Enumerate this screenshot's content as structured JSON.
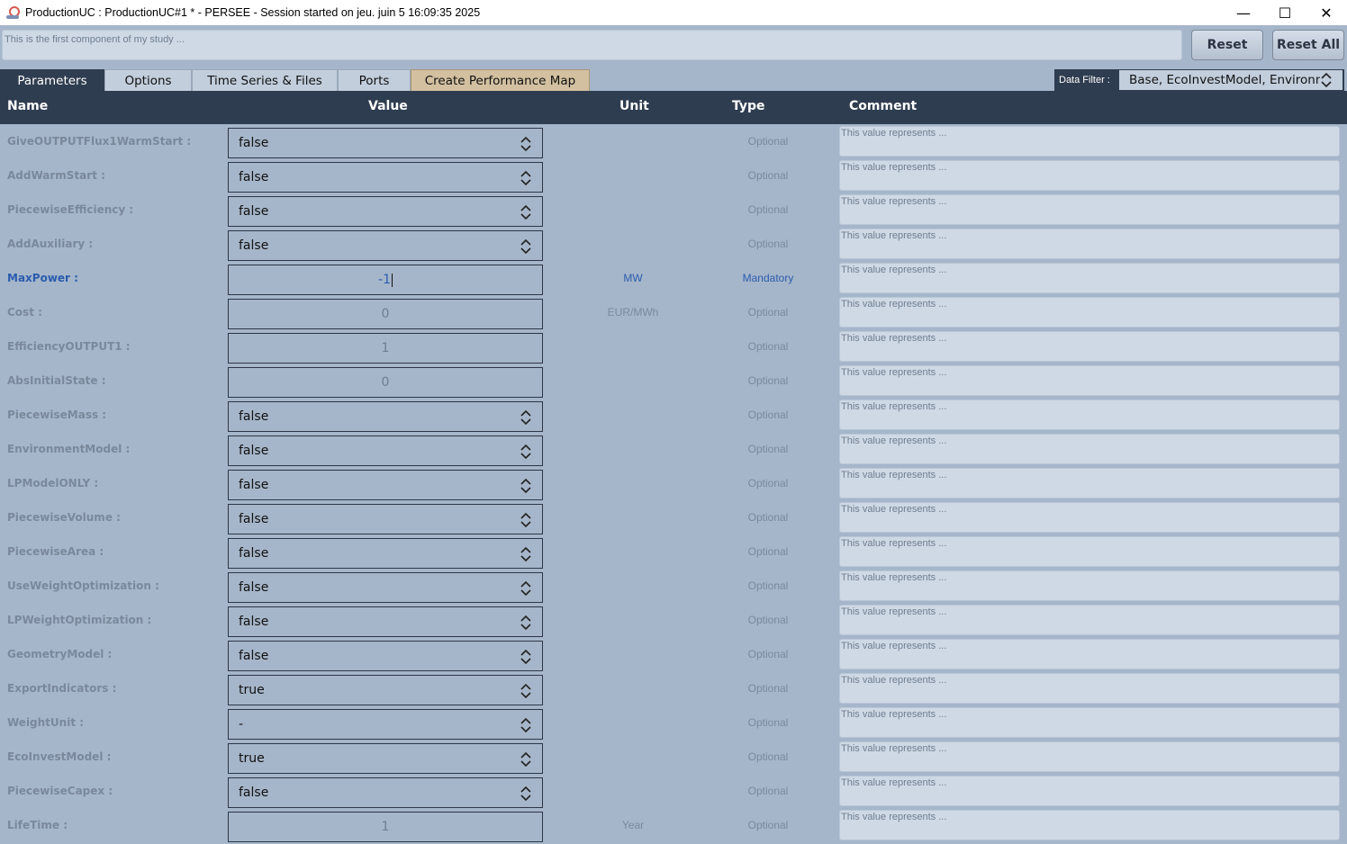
{
  "window": {
    "title": "ProductionUC : ProductionUC#1 * - PERSEE - Session started on jeu. juin 5 16:09:35 2025",
    "minimize": "—",
    "maximize": "☐",
    "close": "✕"
  },
  "description": {
    "placeholder": "This is the first component of my study ..."
  },
  "buttons": {
    "reset": "Reset",
    "reset_all": "Reset All"
  },
  "tabs": [
    {
      "label": "Parameters",
      "active": true
    },
    {
      "label": "Options"
    },
    {
      "label": "Time Series & Files"
    },
    {
      "label": "Ports"
    },
    {
      "label": "Create Performance Map"
    }
  ],
  "filter": {
    "label": "Data Filter :",
    "value": "Base, EcoInvestModel, Environm"
  },
  "columns": {
    "name": "Name",
    "value": "Value",
    "unit": "Unit",
    "type": "Type",
    "comment": "Comment"
  },
  "rows": [
    {
      "name": "GiveOUTPUTFlux1WarmStart :",
      "value": "false",
      "kind": "select",
      "unit": "",
      "type": "Optional",
      "comment": "This value represents ..."
    },
    {
      "name": "AddWarmStart :",
      "value": "false",
      "kind": "select",
      "unit": "",
      "type": "Optional",
      "comment": "This value represents ..."
    },
    {
      "name": "PiecewiseEfficiency :",
      "value": "false",
      "kind": "select",
      "unit": "",
      "type": "Optional",
      "comment": "This value represents ..."
    },
    {
      "name": "AddAuxiliary :",
      "value": "false",
      "kind": "select",
      "unit": "",
      "type": "Optional",
      "comment": "This value represents ..."
    },
    {
      "name": "MaxPower :",
      "value": "-1",
      "kind": "number",
      "editing": true,
      "unit": "MW",
      "type": "Mandatory",
      "comment": "This value represents ..."
    },
    {
      "name": "Cost :",
      "value": "0",
      "kind": "number",
      "unit": "EUR/MWh",
      "type": "Optional",
      "comment": "This value represents ..."
    },
    {
      "name": "EfficiencyOUTPUT1 :",
      "value": "1",
      "kind": "number",
      "unit": "",
      "type": "Optional",
      "comment": "This value represents ..."
    },
    {
      "name": "AbsInitialState :",
      "value": "0",
      "kind": "number",
      "unit": "",
      "type": "Optional",
      "comment": "This value represents ..."
    },
    {
      "name": "PiecewiseMass :",
      "value": "false",
      "kind": "select",
      "unit": "",
      "type": "Optional",
      "comment": "This value represents ..."
    },
    {
      "name": "EnvironmentModel :",
      "value": "false",
      "kind": "select",
      "unit": "",
      "type": "Optional",
      "comment": "This value represents ..."
    },
    {
      "name": "LPModelONLY :",
      "value": "false",
      "kind": "select",
      "unit": "",
      "type": "Optional",
      "comment": "This value represents ..."
    },
    {
      "name": "PiecewiseVolume :",
      "value": "false",
      "kind": "select",
      "unit": "",
      "type": "Optional",
      "comment": "This value represents ..."
    },
    {
      "name": "PiecewiseArea :",
      "value": "false",
      "kind": "select",
      "unit": "",
      "type": "Optional",
      "comment": "This value represents ..."
    },
    {
      "name": "UseWeightOptimization :",
      "value": "false",
      "kind": "select",
      "unit": "",
      "type": "Optional",
      "comment": "This value represents ..."
    },
    {
      "name": "LPWeightOptimization :",
      "value": "false",
      "kind": "select",
      "unit": "",
      "type": "Optional",
      "comment": "This value represents ..."
    },
    {
      "name": "GeometryModel :",
      "value": "false",
      "kind": "select",
      "unit": "",
      "type": "Optional",
      "comment": "This value represents ..."
    },
    {
      "name": "ExportIndicators :",
      "value": "true",
      "kind": "select",
      "unit": "",
      "type": "Optional",
      "comment": "This value represents ..."
    },
    {
      "name": "WeightUnit :",
      "value": "-",
      "kind": "select",
      "unit": "",
      "type": "Optional",
      "comment": "This value represents ..."
    },
    {
      "name": "EcoInvestModel :",
      "value": "true",
      "kind": "select",
      "unit": "",
      "type": "Optional",
      "comment": "This value represents ..."
    },
    {
      "name": "PiecewiseCapex :",
      "value": "false",
      "kind": "select",
      "unit": "",
      "type": "Optional",
      "comment": "This value represents ..."
    },
    {
      "name": "LifeTime :",
      "value": "1",
      "kind": "number",
      "unit": "Year",
      "type": "Optional",
      "comment": "This value represents ..."
    }
  ]
}
